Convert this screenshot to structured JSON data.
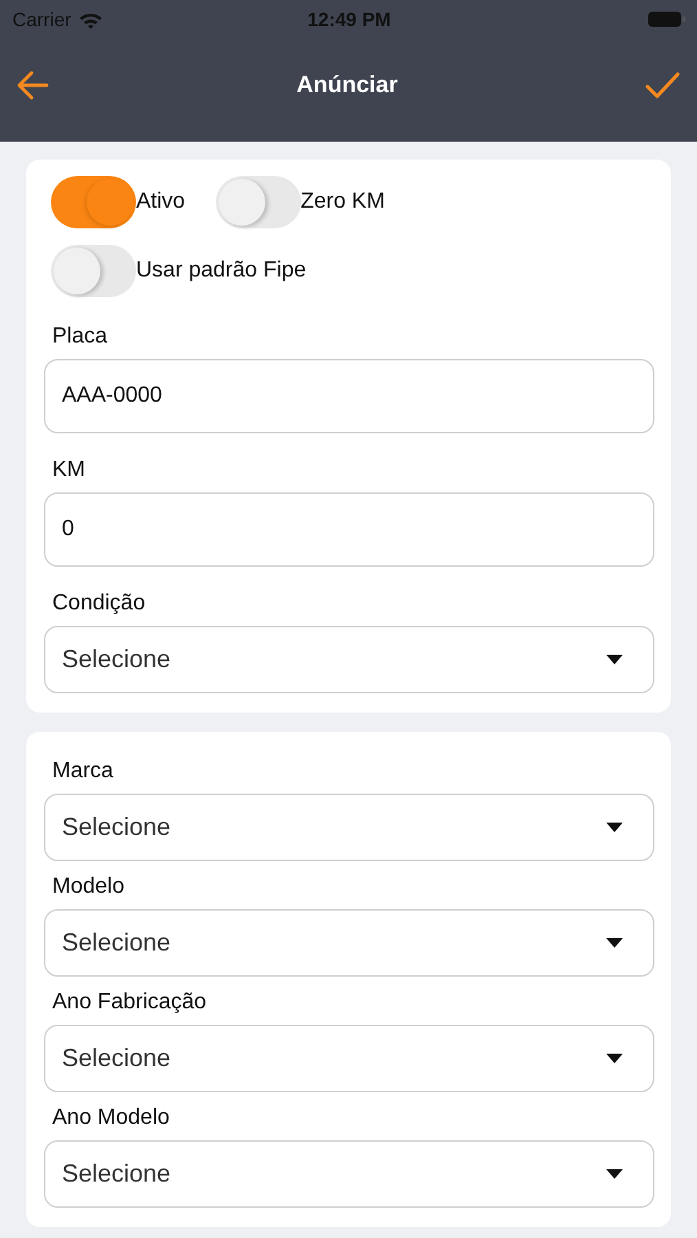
{
  "status_bar": {
    "carrier": "Carrier",
    "time": "12:49 PM"
  },
  "nav_bar": {
    "title": "Anúnciar"
  },
  "sections": [
    {
      "toggle_rows": [
        [
          {
            "label": "Ativo",
            "on": true
          },
          {
            "label": "Zero KM",
            "on": false
          }
        ],
        [
          {
            "label": "Usar padrão Fipe",
            "on": false
          }
        ]
      ],
      "fields": [
        {
          "kind": "text",
          "label": "Placa",
          "value": "AAA-0000"
        },
        {
          "kind": "text",
          "label": "KM",
          "value": "0"
        },
        {
          "kind": "select",
          "label": "Condição",
          "value": "Selecione"
        }
      ]
    },
    {
      "fields": [
        {
          "kind": "select",
          "label": "Marca",
          "value": "Selecione"
        },
        {
          "kind": "select",
          "label": "Modelo",
          "value": "Selecione"
        },
        {
          "kind": "select",
          "label": "Ano Fabricação",
          "value": "Selecione"
        },
        {
          "kind": "select",
          "label": "Ano Modelo",
          "value": "Selecione"
        }
      ]
    }
  ]
}
